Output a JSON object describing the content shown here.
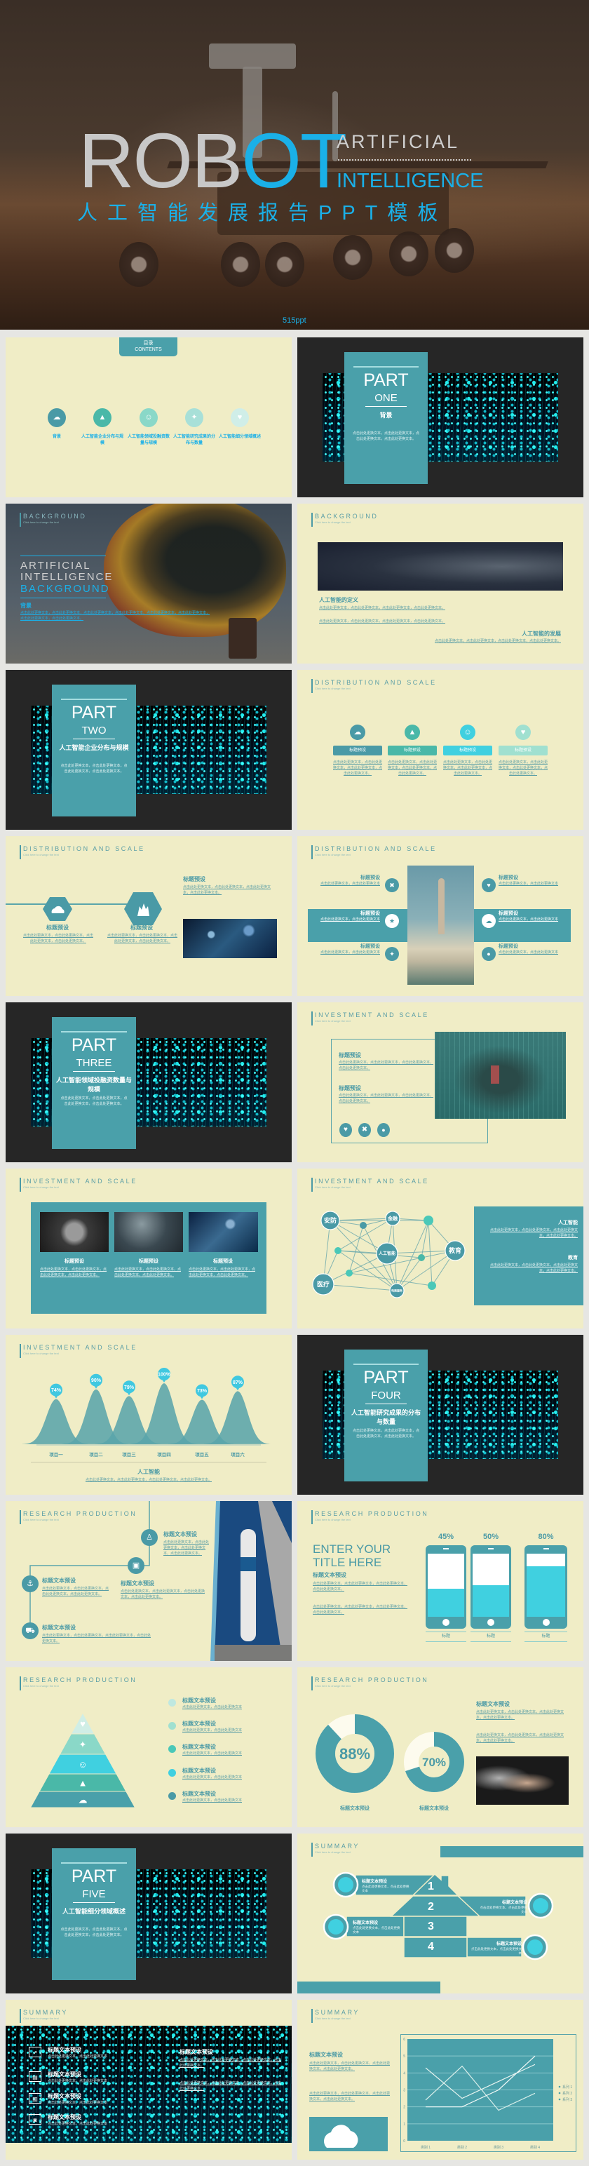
{
  "banner": {
    "title_gray": "ROB",
    "title_blue": "OT",
    "word1": "ARTIFICIAL",
    "word2": "INTELLIGENCE",
    "subtitle": "人工智能发展报告PPT模板",
    "brand": "515ppt"
  },
  "colors": {
    "teal": "#4aa0aa",
    "cream": "#f0edc6",
    "dark": "#262626",
    "cyan": "#40d0e0",
    "blue": "#1ab0e8",
    "gray": "#c8c8c8"
  },
  "ph": "点击此处更换文本，点击此处更换文本，点击此处更换文本，点击此处更换文本。",
  "ph_short": "点击此处更换文本，点击此处更换文本",
  "click_hint": "Click here to change the text",
  "tag_title": "标题预设",
  "tag_title2": "标题文本预设",
  "tag_label": "标题",
  "contents": {
    "tab_cn": "目录",
    "tab_en": "CONTENTS",
    "items": [
      {
        "label": "背景",
        "icon": "cloud-icon"
      },
      {
        "label": "人工智能企业分布与规模",
        "icon": "chart-icon"
      },
      {
        "label": "人工智能领域投融资数量与规模",
        "icon": "smile-icon"
      },
      {
        "label": "人工智能研究成果的分布与数量",
        "icon": "lightbulb-icon"
      },
      {
        "label": "人工智能细分领域概述",
        "icon": "heart-icon"
      }
    ]
  },
  "parts": [
    {
      "label": "PART",
      "num": "ONE",
      "title": "背景"
    },
    {
      "label": "PART",
      "num": "TWO",
      "title": "人工智能企业分布与规模"
    },
    {
      "label": "PART",
      "num": "THREE",
      "title": "人工智能领域投融资数量与规模"
    },
    {
      "label": "PART",
      "num": "FOUR",
      "title": "人工智能研究成果的分布与数量"
    },
    {
      "label": "PART",
      "num": "FIVE",
      "title": "人工智能细分领域概述"
    }
  ],
  "sections": {
    "background": "BACKGROUND",
    "distribution": "DISTRIBUTION AND SCALE",
    "investment": "INVESTMENT AND SCALE",
    "research": "RESEARCH PRODUCTION",
    "summary": "SUMMARY"
  },
  "bg_slide": {
    "line1": "ARTIFICIAL",
    "line2": "INTELLIGENCE",
    "line3": "BACKGROUND",
    "heading": "背景"
  },
  "bg2": {
    "h1": "人工智能的定义",
    "h2": "人工智能的发展"
  },
  "enter_title": "ENTER YOUR TITLE HERE",
  "network": {
    "nodes": [
      "安防",
      "金融",
      "人工智能",
      "教育",
      "医疗",
      "电商服务"
    ],
    "panel": [
      "人工智能",
      "教育"
    ]
  },
  "house_numbers": [
    "1",
    "2",
    "3",
    "4"
  ],
  "chart_data": [
    {
      "type": "bar",
      "style": "bell-curves",
      "categories": [
        "项目一",
        "项目二",
        "项目三",
        "项目四",
        "项目五",
        "项目六"
      ],
      "values": [
        74,
        90,
        79,
        100,
        73,
        87
      ],
      "unit": "%",
      "xlabel": "人工智能"
    },
    {
      "type": "bar",
      "style": "phone-fill",
      "categories": [
        "标题",
        "标题",
        "标题"
      ],
      "values": [
        45,
        50,
        80
      ],
      "unit": "%"
    },
    {
      "type": "pie",
      "style": "donut",
      "categories": [
        "标题文本预设",
        "标题文本预设"
      ],
      "values": [
        88,
        70
      ],
      "unit": "%"
    },
    {
      "type": "line",
      "categories": [
        "类别 1",
        "类别 2",
        "类别 3",
        "类别 4"
      ],
      "ylim": [
        0,
        6
      ],
      "yticks": [
        0,
        1,
        2,
        3,
        4,
        5,
        6
      ],
      "grid": true,
      "legend": "right",
      "series": [
        {
          "name": "系列 1",
          "values": [
            4.3,
            2.5,
            3.5,
            4.5
          ]
        },
        {
          "name": "系列 2",
          "values": [
            2.4,
            4.4,
            1.8,
            2.8
          ]
        },
        {
          "name": "系列 3",
          "values": [
            2,
            2,
            3,
            5
          ]
        }
      ]
    }
  ]
}
